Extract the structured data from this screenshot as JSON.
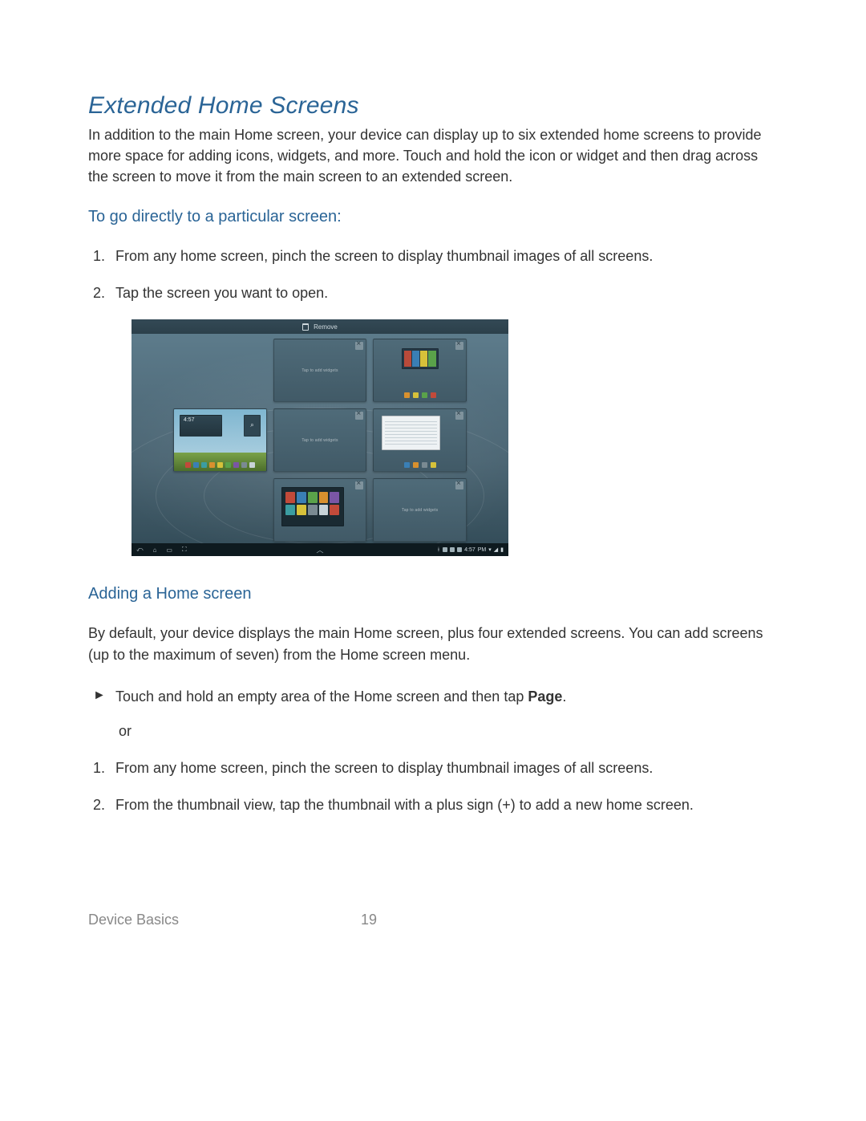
{
  "title": "Extended Home Screens",
  "intro": "In addition to the main Home screen, your device can display up to six extended home screens to provide more space for adding icons, widgets, and more. Touch and hold the icon or widget and then drag across the screen to move it from the main screen to an extended screen.",
  "section1_heading": "To go directly to a particular screen:",
  "section1_steps": [
    "From any home screen, pinch the screen to display thumbnail images of all screens.",
    "Tap the screen you want to open."
  ],
  "section2_heading": "Adding a Home screen",
  "section2_intro": "By default, your device displays the main Home screen, plus four extended screens. You can add screens (up to the maximum of seven) from the Home screen menu.",
  "section2_bullet_prefix": "Touch and hold an empty area of the Home screen and then tap ",
  "section2_bullet_bold": "Page",
  "section2_bullet_suffix": ".",
  "section2_or": "or",
  "section2_steps": [
    "From any home screen, pinch the screen to display thumbnail images of all screens.",
    "From the thumbnail view, tap the thumbnail with a plus sign (+) to add a new home screen."
  ],
  "screenshot": {
    "topbar_label": "Remove",
    "panel_placeholder": "Tap to add widgets",
    "clock_time_top": "4:57",
    "navbar_time": "4:57",
    "navbar_ampm": "PM"
  },
  "footer_section": "Device Basics",
  "page_number": "19",
  "marker_triangle": "►"
}
